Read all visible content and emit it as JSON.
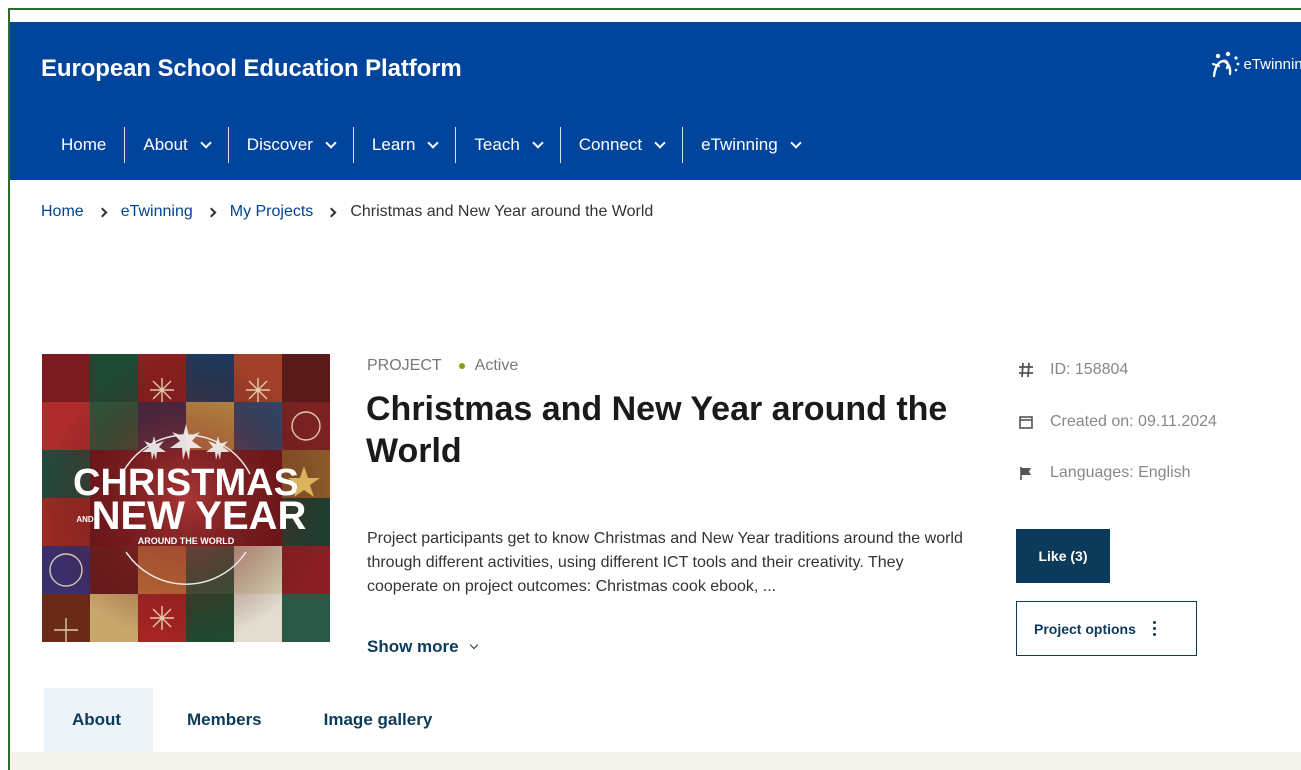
{
  "header": {
    "site_title": "European School Education Platform",
    "logo_text": "eTwinning"
  },
  "nav": {
    "items": [
      {
        "label": "Home",
        "has_dropdown": false
      },
      {
        "label": "About",
        "has_dropdown": true
      },
      {
        "label": "Discover",
        "has_dropdown": true
      },
      {
        "label": "Learn",
        "has_dropdown": true
      },
      {
        "label": "Teach",
        "has_dropdown": true
      },
      {
        "label": "Connect",
        "has_dropdown": true
      },
      {
        "label": "eTwinning",
        "has_dropdown": true
      }
    ]
  },
  "breadcrumb": {
    "items": [
      "Home",
      "eTwinning",
      "My Projects"
    ],
    "current": "Christmas and New Year around the World"
  },
  "project": {
    "image_text": {
      "line1": "CHRISTMAS",
      "and": "AND",
      "line2": "NEW YEAR",
      "line3": "AROUND THE WORLD"
    },
    "type_label": "PROJECT",
    "status": "Active",
    "title": "Christmas and New Year around the World",
    "description": "Project participants get to know Christmas and New Year traditions around the world through different activities, using different ICT tools and their creativity. They cooperate on project outcomes: Christmas cook ebook, ...",
    "show_more": "Show more"
  },
  "sidebar": {
    "id": "ID: 158804",
    "created": "Created on: 09.11.2024",
    "languages": "Languages: English",
    "like_label": "Like (3)",
    "options_label": "Project options"
  },
  "tabs": [
    {
      "label": "About",
      "active": true
    },
    {
      "label": "Members",
      "active": false
    },
    {
      "label": "Image gallery",
      "active": false
    }
  ],
  "colors": {
    "header_bg": "#00449b",
    "primary_dark": "#0b3a5b",
    "status_green": "#7ea30a",
    "tab_active_bg": "#eef3fa"
  }
}
